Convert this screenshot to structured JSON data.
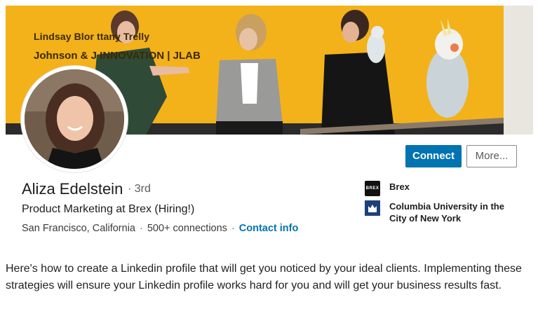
{
  "banner": {
    "line1": "Lindsay Blor        ttany Trelly",
    "line2": "Johnson & J       INNOVATION  |  JLAB"
  },
  "actions": {
    "connect_label": "Connect",
    "more_label": "More..."
  },
  "profile": {
    "name": "Aliza Edelstein",
    "degree": "· 3rd",
    "headline": "Product Marketing at Brex (Hiring!)",
    "location": "San Francisco, California",
    "connections": "500+ connections",
    "contact_info": "Contact info"
  },
  "organizations": [
    {
      "name": "Brex",
      "logo_text": "BREX",
      "logo_icon": "brex-logo"
    },
    {
      "name": "Columbia University in the City of New York",
      "logo_icon": "columbia-crown-logo"
    }
  ],
  "article": {
    "text": "Here's how to create a Linkedin profile that will get you noticed by your ideal clients. Implementing these strategies will ensure your Linkedin profile works hard for you and will get your business results fast."
  },
  "colors": {
    "accent": "#0073b1",
    "banner": "#f3b21a"
  }
}
